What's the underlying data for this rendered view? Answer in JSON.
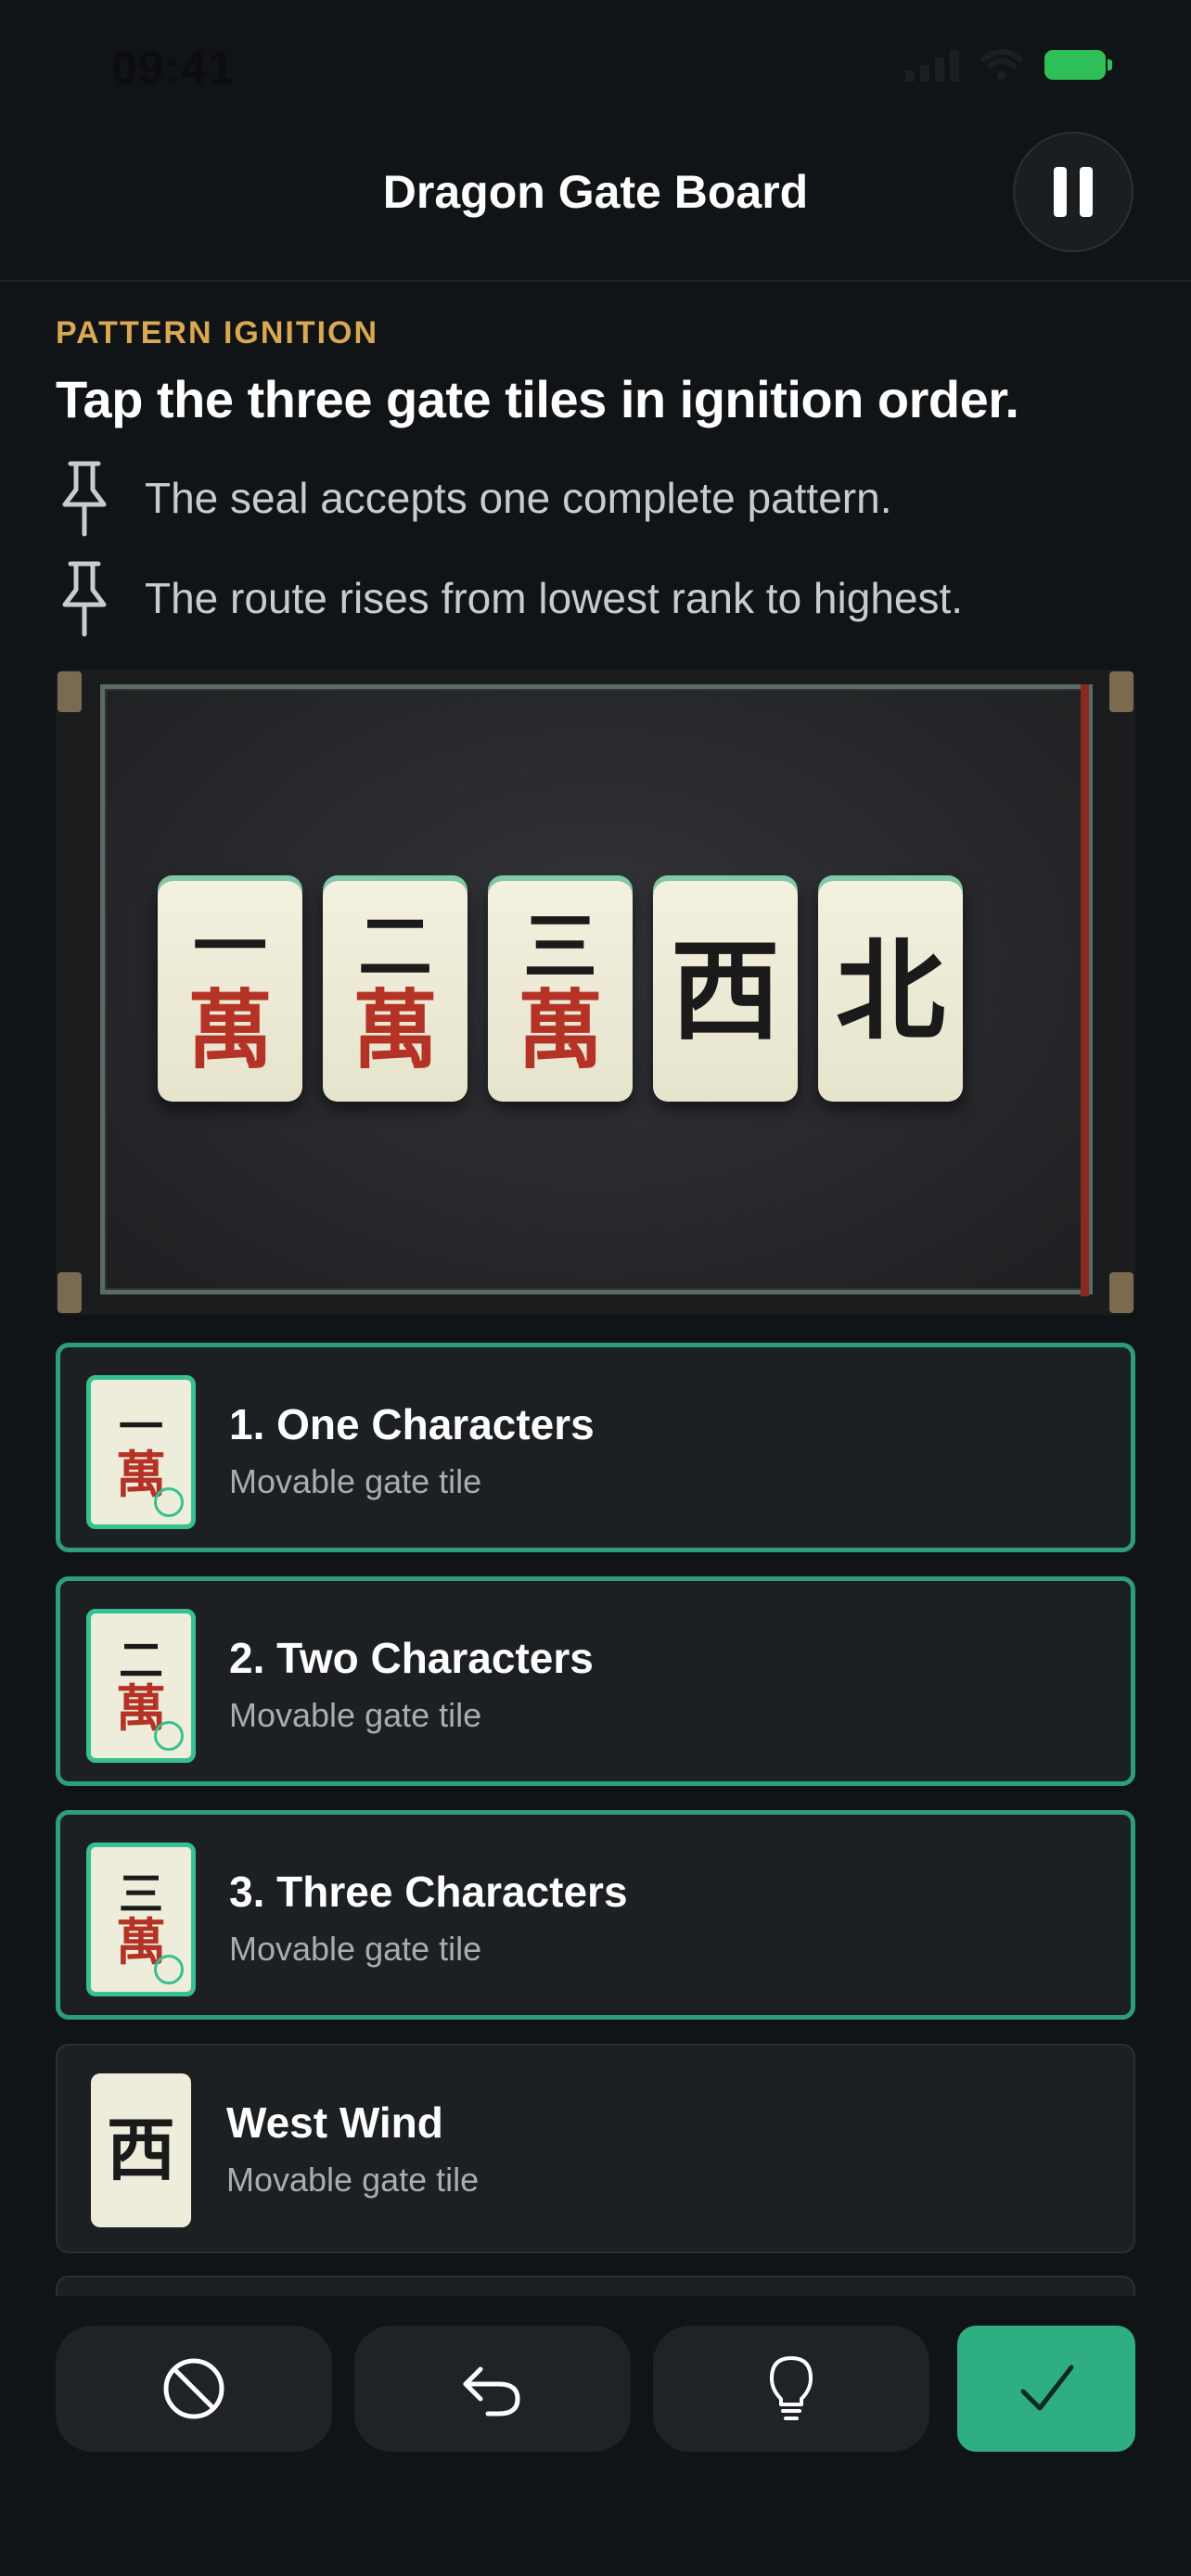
{
  "status_bar": {
    "time": "09:41"
  },
  "header": {
    "title": "Dragon Gate Board"
  },
  "instructions": {
    "eyebrow": "PATTERN IGNITION",
    "heading": "Tap the three gate tiles in ignition order.",
    "rules": [
      "The seal accepts one complete pattern.",
      "The route rises from lowest rank to highest."
    ]
  },
  "board": {
    "tiles": [
      {
        "rank": "一",
        "suit": "萬"
      },
      {
        "rank": "二",
        "suit": "萬"
      },
      {
        "rank": "三",
        "suit": "萬"
      },
      {
        "honor": "西"
      },
      {
        "honor": "北"
      }
    ]
  },
  "tile_list": [
    {
      "title": "1. One Characters",
      "subtitle": "Movable gate tile",
      "rank": "一",
      "suit": "萬",
      "selected": true
    },
    {
      "title": "2. Two Characters",
      "subtitle": "Movable gate tile",
      "rank": "二",
      "suit": "萬",
      "selected": true
    },
    {
      "title": "3. Three Characters",
      "subtitle": "Movable gate tile",
      "rank": "三",
      "suit": "萬",
      "selected": true
    },
    {
      "title": "West Wind",
      "subtitle": "Movable gate tile",
      "honor": "西",
      "selected": false
    }
  ],
  "toolbar": {
    "buttons": [
      "clear-icon",
      "undo-icon",
      "hint-icon",
      "confirm-check-icon"
    ]
  },
  "colors": {
    "accent_green": "#2fae82",
    "selected_border": "#2e9e78",
    "eyebrow_gold": "#d9a852",
    "character_red": "#b43226"
  }
}
